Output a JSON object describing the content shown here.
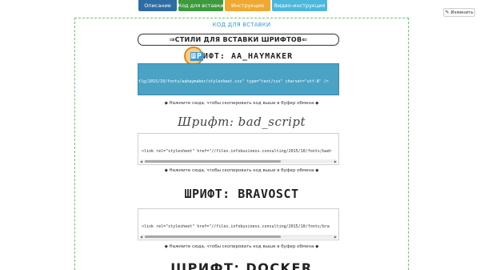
{
  "tabs": [
    {
      "label": "Описание",
      "color": "#2e6da4"
    },
    {
      "label": "Код для вставки",
      "color": "#3c9a3c"
    },
    {
      "label": "Инструкция",
      "color": "#f0a830"
    },
    {
      "label": "Видео-инструкция",
      "color": "#4bb7dd"
    }
  ],
  "edit_button": {
    "icon": "pencil-icon",
    "label": "Изменить"
  },
  "section_title": "КОД ДЛЯ ВСТАВКИ",
  "styles_box": "⇒СТИЛИ ДЛЯ ВСТАВКИ ШРИФТОВ⇐",
  "fonts": [
    {
      "heading_prefix": "ШР",
      "heading_rest": "ИФТ: AA_HAYMAKER",
      "code": "tlg/2015/10/fonts/aahaymaker/stylesheet.css\" type=\"text/css\" charset=\"utf-8\" />",
      "copy_hint": "◆ Нажмите сюда, чтобы скопировать код выше в буфер обмена ◆"
    },
    {
      "heading": "Шрифт: bad_script",
      "code": "<link rel=\"stylesheet\" href=\"//files.infobusiness.consulting/2015/10/fonts/badr",
      "copy_hint": "◆ Нажмите сюда, чтобы скопировать код выше в буфер обмена ◆"
    },
    {
      "heading": "ШРИФТ: BRAVOSCT",
      "code": "<link rel=\"stylesheet\" href=\"//files.infobusiness.consulting/2015/10/fonts/bra",
      "copy_hint": "◆ Нажмите сюда, чтобы скопировать код выше в буфер обмена ◆"
    },
    {
      "heading": "ШРИФТ: DOCKER"
    }
  ],
  "colors": {
    "accent": "#3d9ad1",
    "dashed_border": "#6cc36c",
    "selected_code": "#4aa3c5"
  }
}
